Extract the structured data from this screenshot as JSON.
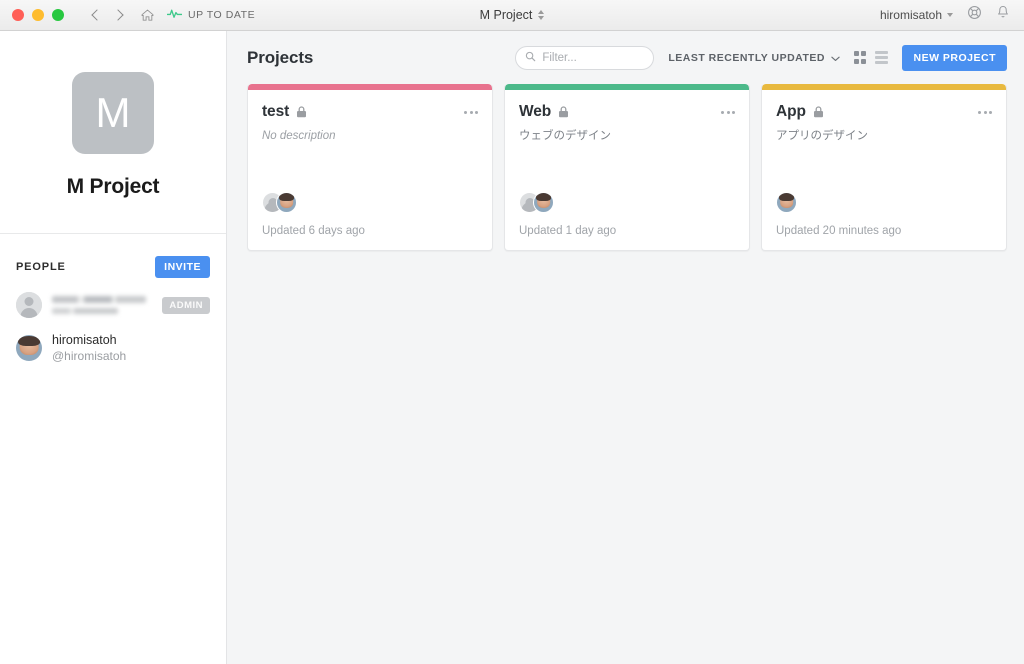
{
  "titlebar": {
    "nav": {
      "back_icon": "chevron-left-icon",
      "forward_icon": "chevron-right-icon",
      "home_icon": "home-icon"
    },
    "sync_status": "UP TO DATE",
    "sync_icon": "pulse-icon",
    "window_title": "M Project",
    "title_selector_icon": "up-down-chevron-icon",
    "user": "hiromisatoh",
    "user_caret_icon": "chevron-down-icon",
    "help_icon": "lifebuoy-icon",
    "notifications_icon": "bell-icon"
  },
  "sidebar": {
    "team": {
      "avatar_initial": "M",
      "name": "M Project"
    },
    "people": {
      "heading": "PEOPLE",
      "invite_label": "INVITE",
      "members": [
        {
          "name": "",
          "handle": "",
          "redacted": true,
          "badge": "ADMIN",
          "avatar": "placeholder"
        },
        {
          "name": "hiromisatoh",
          "handle": "@hiromisatoh",
          "redacted": false,
          "badge": "",
          "avatar": "photo"
        }
      ]
    }
  },
  "main": {
    "page_title": "Projects",
    "filter": {
      "placeholder": "Filter...",
      "value": "",
      "icon": "search-icon"
    },
    "sort": {
      "label": "LEAST RECENTLY UPDATED",
      "icon": "chevron-down-icon"
    },
    "view": {
      "grid_icon": "grid-view-icon",
      "list_icon": "list-view-icon",
      "active": "grid"
    },
    "new_project_label": "NEW PROJECT",
    "projects": [
      {
        "title": "test",
        "description": "No description",
        "no_description": true,
        "updated": "Updated 6 days ago",
        "stripe_color": "#e8728e",
        "lock_icon": "lock-icon",
        "menu_icon": "ellipsis-icon",
        "avatars": [
          "placeholder",
          "photo"
        ]
      },
      {
        "title": "Web",
        "description": "ウェブのデザイン",
        "no_description": false,
        "updated": "Updated 1 day ago",
        "stripe_color": "#4cb98a",
        "lock_icon": "lock-icon",
        "menu_icon": "ellipsis-icon",
        "avatars": [
          "placeholder",
          "photo"
        ]
      },
      {
        "title": "App",
        "description": "アプリのデザイン",
        "no_description": false,
        "updated": "Updated 20 minutes ago",
        "stripe_color": "#e8b93f",
        "lock_icon": "lock-icon",
        "menu_icon": "ellipsis-icon",
        "avatars": [
          "photo"
        ]
      }
    ]
  },
  "colors": {
    "accent_blue": "#4a90f0",
    "sync_green": "#3dc98a",
    "content_bg": "#f4f5f6"
  }
}
